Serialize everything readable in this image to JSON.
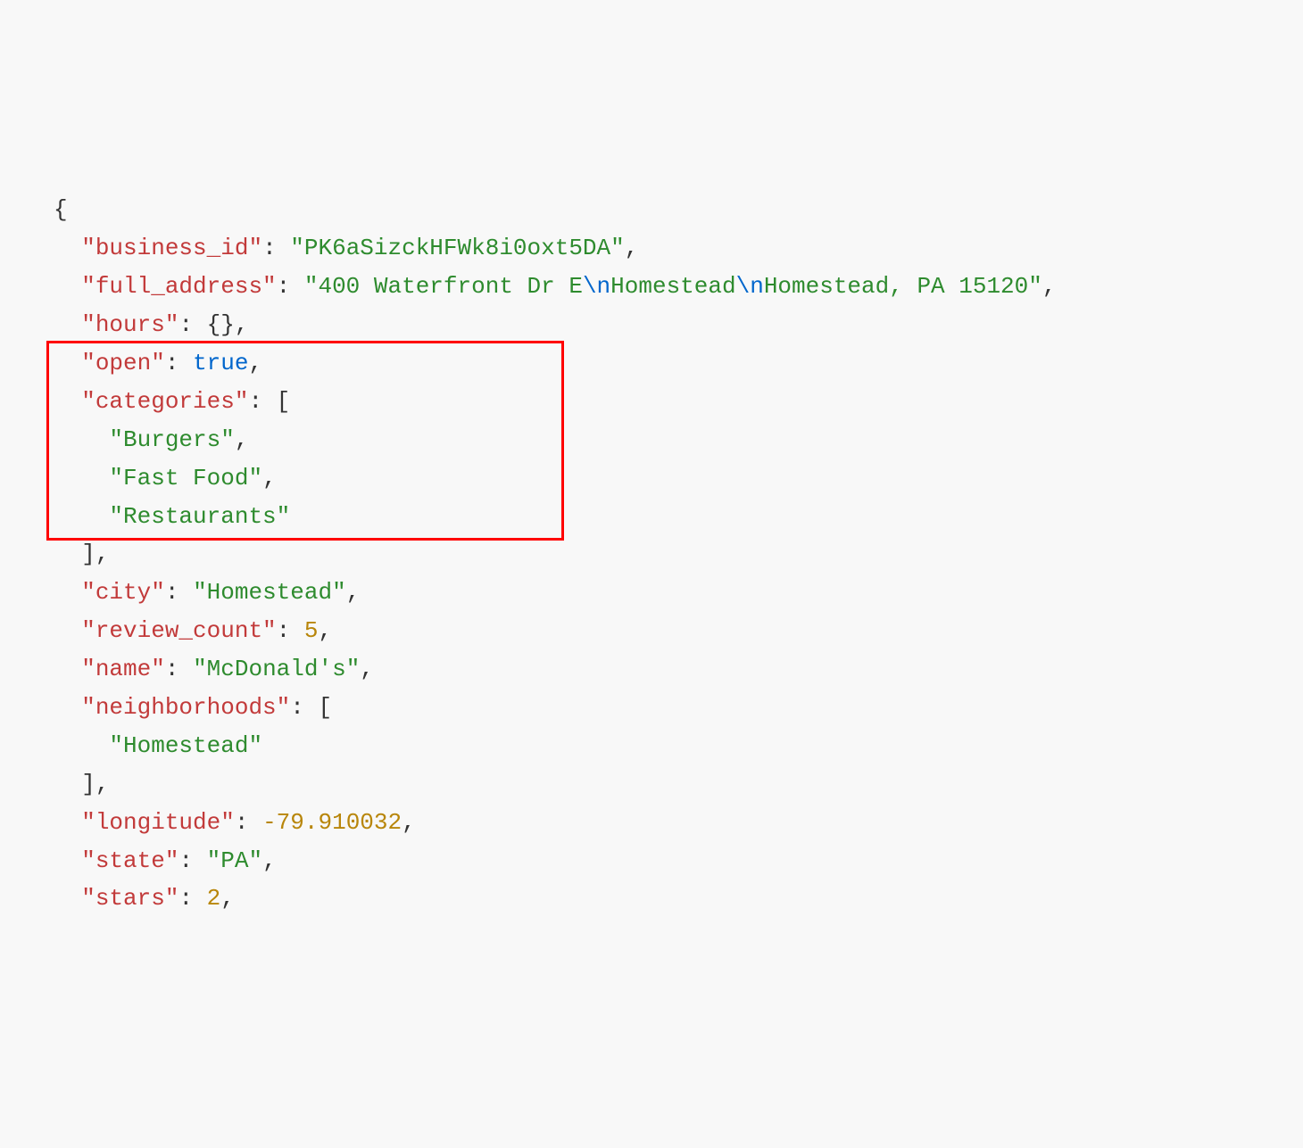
{
  "json_display": {
    "keys": {
      "business_id": "\"business_id\"",
      "full_address": "\"full_address\"",
      "hours": "\"hours\"",
      "open": "\"open\"",
      "categories": "\"categories\"",
      "city": "\"city\"",
      "review_count": "\"review_count\"",
      "name": "\"name\"",
      "neighborhoods": "\"neighborhoods\"",
      "longitude": "\"longitude\"",
      "state": "\"state\"",
      "stars": "\"stars\""
    },
    "values": {
      "business_id": "\"PK6aSizckHFWk8i0oxt5DA\"",
      "full_address_part1": "\"400 Waterfront Dr E",
      "full_address_escape1": "\\n",
      "full_address_part2": "Homestead",
      "full_address_escape2": "\\n",
      "full_address_part3": "Homestead, PA 15120\"",
      "hours": "{}",
      "open": "true",
      "categories_0": "\"Burgers\"",
      "categories_1": "\"Fast Food\"",
      "categories_2": "\"Restaurants\"",
      "city": "\"Homestead\"",
      "review_count": "5",
      "name": "\"McDonald's\"",
      "neighborhoods_0": "\"Homestead\"",
      "longitude": "-79.910032",
      "state": "\"PA\"",
      "stars": "2"
    },
    "punctuation": {
      "open_brace": "{",
      "close_brace": "}",
      "open_bracket": "[",
      "close_bracket": "]",
      "colon": ":",
      "comma": ",",
      "colon_space": ": "
    }
  }
}
